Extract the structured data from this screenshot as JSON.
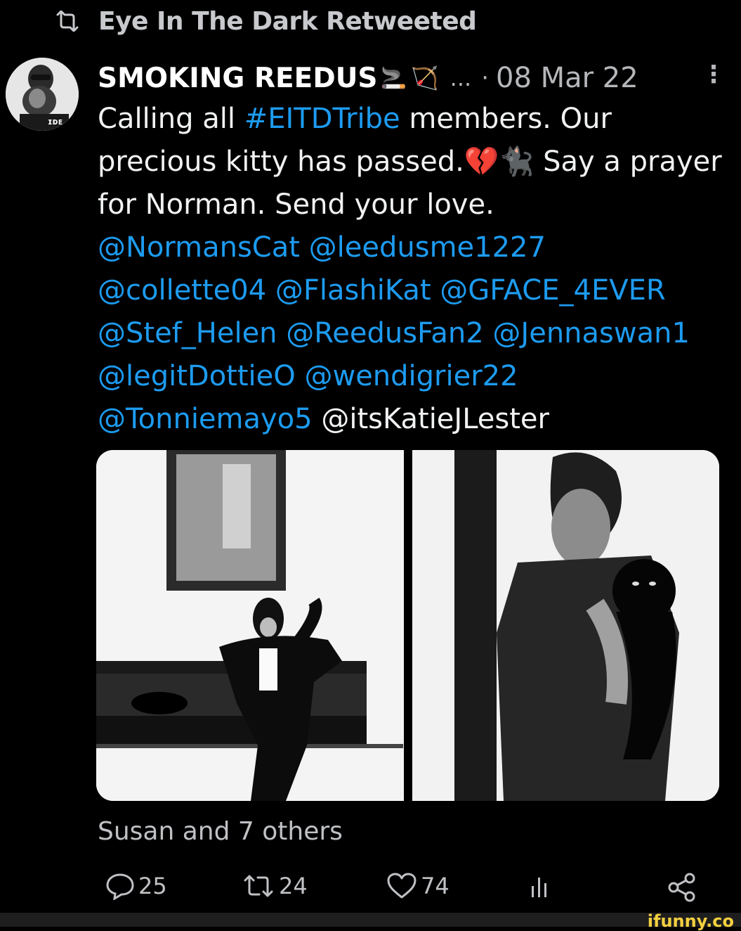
{
  "retweet": {
    "icon": "retweet-icon",
    "label": "Eye In The Dark Retweeted"
  },
  "tweet": {
    "author_name": "SMOKING REEDUS",
    "author_emoji_1": "🚬",
    "author_emoji_2": "🏹",
    "ellipsis": "...",
    "separator": "·",
    "date": "08 Mar 22",
    "more_icon": "more-vertical-icon",
    "more_glyph": "⋮",
    "text_parts": {
      "p1": "Calling all ",
      "hashtag": "#EITDTribe",
      "p2": " members. Our precious kitty has passed.",
      "emoji_heart": "💔",
      "emoji_cat": "🐈‍⬛",
      "p3": " Say a prayer for Norman. Send your love.",
      "m1": "@NormansCat",
      "m2": "@leedusme1227",
      "m3": "@collette04",
      "m4": "@FlashiKat",
      "m5": "@GFACE_4EVER",
      "m6": "@Stef_Helen",
      "m7": "@ReedusFan2",
      "m8": "@Jennaswan1",
      "m9": "@legitDottieO",
      "m10": "@wendigrier22",
      "m11": "@Tonniemayo5",
      "plain_mention": "@itsKatieJLester"
    },
    "images": [
      "photo-man-in-tuxedo-on-bench",
      "photo-man-holding-black-cat"
    ],
    "likes_summary": "Susan and 7 others",
    "actions": {
      "reply_count": "25",
      "retweet_count": "24",
      "like_count": "74"
    }
  },
  "watermark": "ifunny.co",
  "colors": {
    "link": "#1d9bf0",
    "background": "#000000",
    "muted": "#bfc1c4"
  }
}
